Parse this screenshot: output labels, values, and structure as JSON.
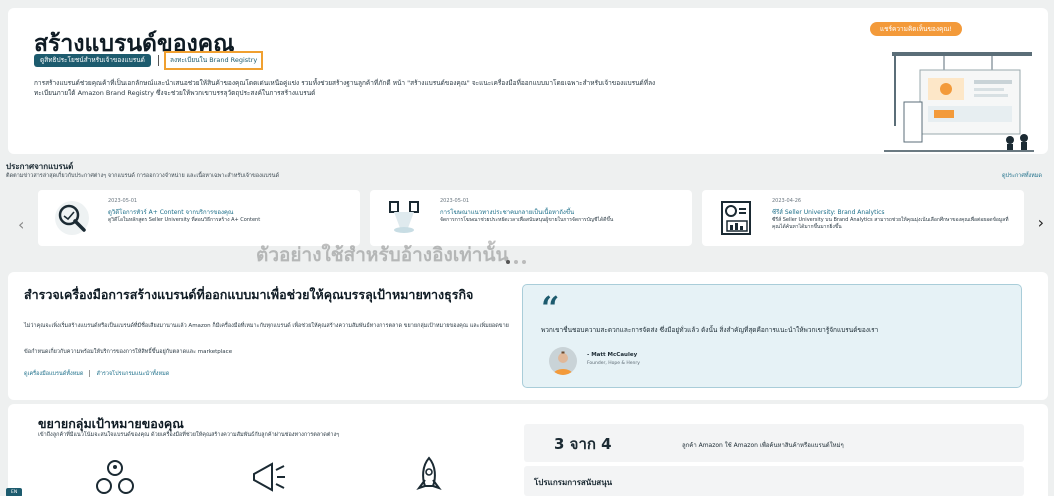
{
  "hero": {
    "title": "สร้างแบรนด์ของคุณ",
    "btn_benefits": "ดูสิทธิประโยชน์สำหรับเจ้าของแบรนด์",
    "btn_enroll": "ลงทะเบียนใน Brand Registry",
    "description": "การสร้างแบรนด์ช่วยคุณค้าที่เป็นเอกลักษณ์และนำเสนอช่วยให้สินค้าของคุณโดดเด่นเหนือคู่แข่ง รวมทั้งช่วยสร้างฐานลูกค้าที่ภักดี หน้า \"สร้างแบรนด์ของคุณ\" จะแนะเครื่องมือที่ออกแบบมาโดยเฉพาะสำหรับเจ้าของแบรนด์ที่ลงทะเบียนภายใต้ Amazon Brand Registry ซึ่งจะช่วยให้พวกเขาบรรลุวัตถุประสงค์ในการสร้างแบรนด์",
    "pill": "แชร์ความคิดเห็นของคุณ!"
  },
  "news": {
    "title": "ประกาศจากแบรนด์",
    "subtitle": "ติดตามข่าวสารล่าสุดเกี่ยวกับประกาศต่างๆ จากแบรนด์ การออกวางจำหน่าย และเนื้อหาเฉพาะสำหรับเจ้าของแบรนด์",
    "see_all": "ดูประกาศทั้งหมด",
    "cards": [
      {
        "date": "2023-05-01",
        "title": "ดูวิดีโอการทัวร์ A+ Content จากบริการของคุณ",
        "desc": "ดูวิดีโอในหลักสูตร Seller University ที่สอนวิธีการสร้าง A+ Content",
        "icon": "magnifier-icon"
      },
      {
        "date": "2023-05-01",
        "title": "การโฆษณาแนวทางประชาคมกลายเป็นเนื้อหาถังขึ้น",
        "desc": "จัดการการโฆษณาช่วยประหยัดเวลาเพื่อสนับสนุนผู้ขายในการจัดการบัญชีได้ดีขึ้น",
        "icon": "spotlight-icon"
      },
      {
        "date": "2023-04-26",
        "title": "ซีรีส์ Seller University: Brand Analytics",
        "desc": "ซีรีส์ Seller University บน Brand Analytics สามารถช่วยให้คุณมุ่งเน้นเลือกศึกษาของคุณเพื่อต่อยอดข้อมูลที่คุณได้ค้นหาได้มากขึ้นมากยิ่งขึ้น",
        "icon": "analytics-board-icon"
      }
    ],
    "watermark": "ตัวอย่างใช้สำหรับอ้างอิงเท่านั้น"
  },
  "explore": {
    "title": "สำรวจเครื่องมือการสร้างแบรนด์ที่ออกแบบมาเพื่อช่วยให้คุณบรรลุเป้าหมายทางธุรกิจ",
    "desc": "ไม่ว่าคุณจะเพิ่งเริ่มสร้างแบรนด์หรือเป็นแบรนด์ที่มีชื่อเสียงมานานแล้ว Amazon ก็มีเครื่องมือที่เหมาะกับทุกแบรนด์ เพื่อช่วยให้คุณสร้างความสัมพันธ์ทางการตลาด ขยายกลุ่มเป้าหมายของคุณ และเพิ่มยอดขาย",
    "desc2": "ข้อกำหนดเกี่ยวกับความพร้อมให้บริการของการให้สิทธิ์ขึ้นอยู่กับตลาดและ marketplace",
    "link1": "ดูเครื่องมือแบรนด์ทั้งหมด",
    "link2": "สำรวจโปรแกรมแนะนำทั้งหมด",
    "quote": "พวกเขาชื่นชอบความสะดวกและการจัดส่ง ซึ่งมีอยู่ทั่วแล้ว ดังนั้น สิ่งสำคัญที่สุดคือการแนะนำให้พวกเขารู้จักแบรนด์ของเรา",
    "quote_name": "- Matt McCauley",
    "quote_role": "Founder, Hope & Henry"
  },
  "grow": {
    "title": "ขยายกลุ่มเป้าหมายของคุณ",
    "desc": "เข้าถึงลูกค้าที่มีแนวโน้มจะสนใจแบรนด์ของคุณ ด้วยเครื่องมือที่ช่วยให้คุณสร้างความสัมพันธ์กับลูกค้าผ่านช่องทางการตลาดต่างๆ",
    "stat_big": "3 จาก 4",
    "stat_text": "ลูกค้า Amazon ใช้ Amazon เพื่อค้นหาสินค้าหรือแบรนด์ใหม่ๆ",
    "programs": "โปรแกรมการสนับสนุน"
  },
  "corner": "EN"
}
